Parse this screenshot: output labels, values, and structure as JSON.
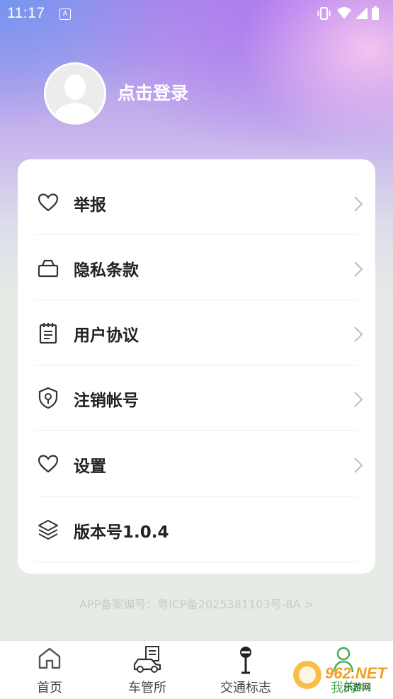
{
  "status_bar": {
    "time": "11:17",
    "notification_badge": "A",
    "icons": [
      "vibrate-icon",
      "wifi-icon",
      "signal-icon",
      "battery-icon"
    ]
  },
  "profile": {
    "avatar_icon": "user-avatar-icon",
    "login_label": "点击登录"
  },
  "menu": {
    "items": [
      {
        "label": "举报",
        "icon": "heart-icon"
      },
      {
        "label": "隐私条款",
        "icon": "lock-icon"
      },
      {
        "label": "用户协议",
        "icon": "clipboard-icon"
      },
      {
        "label": "注销帐号",
        "icon": "shield-keyhole-icon"
      },
      {
        "label": "设置",
        "icon": "heart-icon"
      },
      {
        "label": "版本号1.0.4",
        "icon": "layers-icon"
      }
    ]
  },
  "footer": {
    "icp": "APP备案编号：粤ICP备2025381103号-8A >"
  },
  "tabbar": {
    "tabs": [
      {
        "label": "首页",
        "icon": "home-icon"
      },
      {
        "label": "车管所",
        "icon": "car-icon"
      },
      {
        "label": "交通标志",
        "icon": "road-sign-icon"
      },
      {
        "label": "我的",
        "icon": "profile-icon"
      }
    ]
  },
  "watermark": {
    "text": "962.NET",
    "subtext": "乐游网"
  },
  "colors": {
    "hero_start": "#7f9cf0",
    "hero_end": "#c9a6f0",
    "card": "#ffffff",
    "text": "#222222",
    "chevron": "#bbbbbb",
    "active_tab": "#4caf50"
  }
}
